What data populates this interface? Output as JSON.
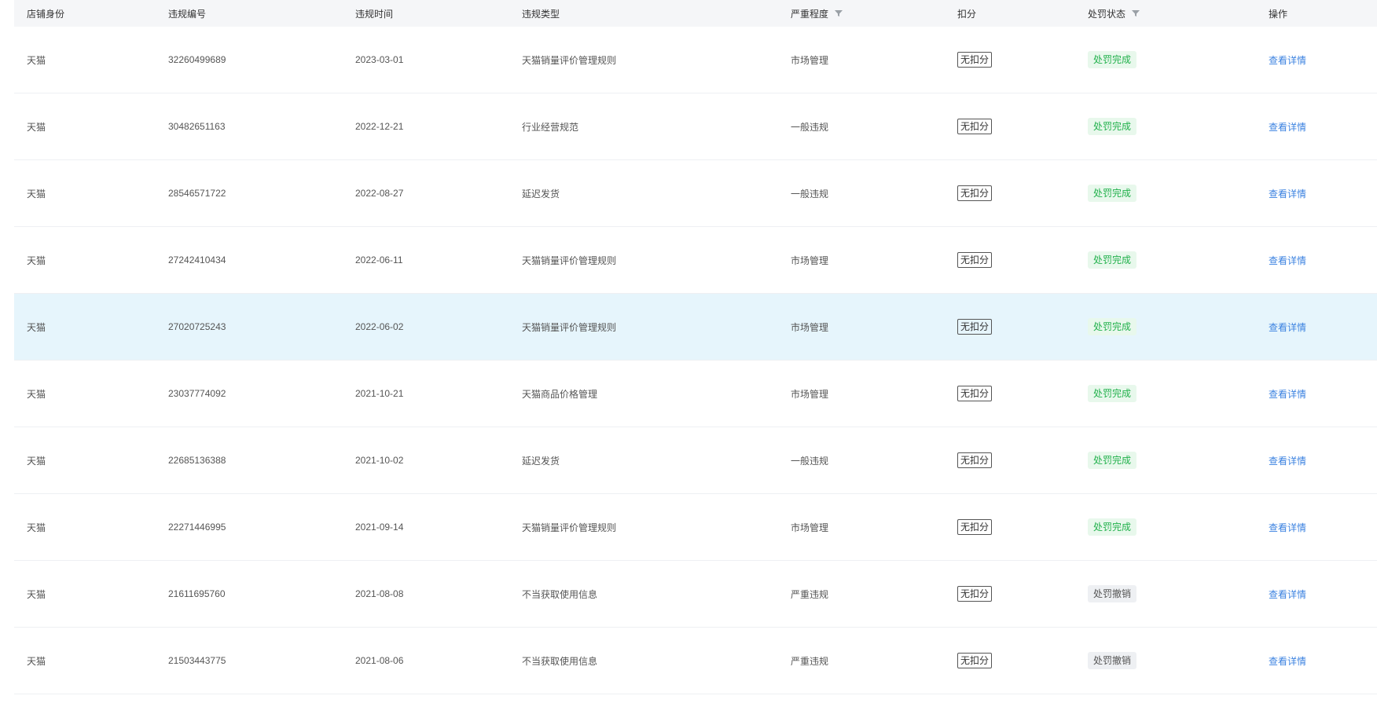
{
  "columns": [
    {
      "label": "店铺身份",
      "filter": false
    },
    {
      "label": "违规编号",
      "filter": false
    },
    {
      "label": "违规时间",
      "filter": false
    },
    {
      "label": "违规类型",
      "filter": false
    },
    {
      "label": "严重程度",
      "filter": true
    },
    {
      "label": "扣分",
      "filter": false
    },
    {
      "label": "处罚状态",
      "filter": true
    },
    {
      "label": "操作",
      "filter": false
    }
  ],
  "rows": [
    {
      "identity": "天猫",
      "code": "32260499689",
      "date": "2023-03-01",
      "type": "天猫销量评价管理规则",
      "severity": "市场管理",
      "score": "无扣分",
      "status": "处罚完成",
      "status_kind": "done",
      "action": "查看详情"
    },
    {
      "identity": "天猫",
      "code": "30482651163",
      "date": "2022-12-21",
      "type": "行业经营规范",
      "severity": "一般违规",
      "score": "无扣分",
      "status": "处罚完成",
      "status_kind": "done",
      "action": "查看详情"
    },
    {
      "identity": "天猫",
      "code": "28546571722",
      "date": "2022-08-27",
      "type": "延迟发货",
      "severity": "一般违规",
      "score": "无扣分",
      "status": "处罚完成",
      "status_kind": "done",
      "action": "查看详情"
    },
    {
      "identity": "天猫",
      "code": "27242410434",
      "date": "2022-06-11",
      "type": "天猫销量评价管理规则",
      "severity": "市场管理",
      "score": "无扣分",
      "status": "处罚完成",
      "status_kind": "done",
      "action": "查看详情"
    },
    {
      "identity": "天猫",
      "code": "27020725243",
      "date": "2022-06-02",
      "type": "天猫销量评价管理规则",
      "severity": "市场管理",
      "score": "无扣分",
      "status": "处罚完成",
      "status_kind": "done",
      "action": "查看详情",
      "highlight": true
    },
    {
      "identity": "天猫",
      "code": "23037774092",
      "date": "2021-10-21",
      "type": "天猫商品价格管理",
      "severity": "市场管理",
      "score": "无扣分",
      "status": "处罚完成",
      "status_kind": "done",
      "action": "查看详情"
    },
    {
      "identity": "天猫",
      "code": "22685136388",
      "date": "2021-10-02",
      "type": "延迟发货",
      "severity": "一般违规",
      "score": "无扣分",
      "status": "处罚完成",
      "status_kind": "done",
      "action": "查看详情"
    },
    {
      "identity": "天猫",
      "code": "22271446995",
      "date": "2021-09-14",
      "type": "天猫销量评价管理规则",
      "severity": "市场管理",
      "score": "无扣分",
      "status": "处罚完成",
      "status_kind": "done",
      "action": "查看详情"
    },
    {
      "identity": "天猫",
      "code": "21611695760",
      "date": "2021-08-08",
      "type": "不当获取使用信息",
      "severity": "严重违规",
      "score": "无扣分",
      "status": "处罚撤销",
      "status_kind": "revoked",
      "action": "查看详情"
    },
    {
      "identity": "天猫",
      "code": "21503443775",
      "date": "2021-08-06",
      "type": "不当获取使用信息",
      "severity": "严重违规",
      "score": "无扣分",
      "status": "处罚撤销",
      "status_kind": "revoked",
      "action": "查看详情"
    }
  ],
  "colors": {
    "header_bg": "#f5f6f8",
    "highlight_row": "#e6f5fc",
    "status_done_text": "#22b14c",
    "status_done_bg": "#e8f8ec",
    "status_revoked_bg": "#eef0f3",
    "link": "#3b82e0"
  }
}
